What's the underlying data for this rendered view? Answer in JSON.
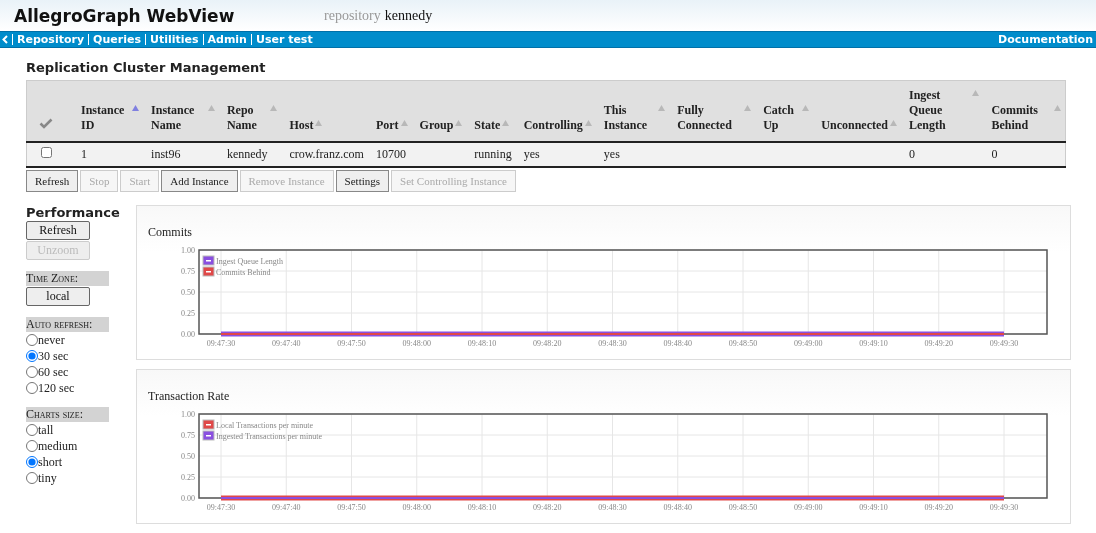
{
  "header": {
    "title": "AllegroGraph WebView",
    "repository_label": "repository",
    "repository_name": "kennedy"
  },
  "nav": {
    "items": [
      "Repository",
      "Queries",
      "Utilities",
      "Admin",
      "User test"
    ],
    "right": "Documentation"
  },
  "cluster": {
    "title": "Replication Cluster Management",
    "table": {
      "columns": [
        {
          "label": "Instance ID",
          "sorted": true
        },
        {
          "label": "Instance Name",
          "sorted": false
        },
        {
          "label": "Repo Name",
          "sorted": false
        },
        {
          "label": "Host",
          "sorted": false
        },
        {
          "label": "Port",
          "sorted": false
        },
        {
          "label": "Group",
          "sorted": false
        },
        {
          "label": "State",
          "sorted": false
        },
        {
          "label": "Controlling",
          "sorted": false
        },
        {
          "label": "This Instance",
          "sorted": false
        },
        {
          "label": "Fully Connected",
          "sorted": false
        },
        {
          "label": "Catch Up",
          "sorted": false
        },
        {
          "label": "Unconnected",
          "sorted": false
        },
        {
          "label": "Ingest Queue Length",
          "sorted": false
        },
        {
          "label": "Commits Behind",
          "sorted": false
        }
      ],
      "rows": [
        {
          "checked": false,
          "cells": [
            "1",
            "inst96",
            "kennedy",
            "crow.franz.com",
            "10700",
            "",
            "running",
            "yes",
            "yes",
            "",
            "",
            "",
            "0",
            "0"
          ]
        }
      ]
    },
    "buttons": [
      {
        "label": "Refresh",
        "disabled": false
      },
      {
        "label": "Stop",
        "disabled": true
      },
      {
        "label": "Start",
        "disabled": true
      },
      {
        "label": "Add Instance",
        "disabled": false
      },
      {
        "label": "Remove Instance",
        "disabled": true
      },
      {
        "label": "Settings",
        "disabled": false
      },
      {
        "label": "Set Controlling Instance",
        "disabled": true
      }
    ]
  },
  "performance": {
    "title": "Performance",
    "buttons": [
      {
        "label": "Refresh",
        "disabled": false
      },
      {
        "label": "Unzoom",
        "disabled": true
      }
    ],
    "time_zone": {
      "label": "Time Zone:",
      "value": "local"
    },
    "auto_refresh": {
      "label": "Auto refresh:",
      "options": [
        {
          "label": "never",
          "selected": false
        },
        {
          "label": "30 sec",
          "selected": true
        },
        {
          "label": "60 sec",
          "selected": false
        },
        {
          "label": "120 sec",
          "selected": false
        }
      ]
    },
    "charts_size": {
      "label": "Charts size:",
      "options": [
        {
          "label": "tall",
          "selected": false
        },
        {
          "label": "medium",
          "selected": false
        },
        {
          "label": "short",
          "selected": true
        },
        {
          "label": "tiny",
          "selected": false
        }
      ]
    }
  },
  "charts": [
    {
      "chart_data": {
        "type": "line",
        "title": "Commits",
        "grid": true,
        "legend": true,
        "categories": [
          "09:47:30",
          "09:47:40",
          "09:47:50",
          "09:48:00",
          "09:48:10",
          "09:48:20",
          "09:48:30",
          "09:48:40",
          "09:48:50",
          "09:49:00",
          "09:49:10",
          "09:49:20",
          "09:49:30"
        ],
        "series": [
          {
            "name": "Ingest Queue Length",
            "color": "#8a4fe0",
            "values": [
              0,
              0,
              0,
              0,
              0,
              0,
              0,
              0,
              0,
              0,
              0,
              0,
              0
            ]
          },
          {
            "name": "Commits Behind",
            "color": "#e04848",
            "values": [
              0,
              0,
              0,
              0,
              0,
              0,
              0,
              0,
              0,
              0,
              0,
              0,
              0
            ]
          }
        ],
        "ylim": [
          0,
          1
        ],
        "yticks": [
          {
            "value": 0,
            "label": "0.00"
          },
          {
            "value": 0.25,
            "label": "0.25"
          },
          {
            "value": 0.5,
            "label": "0.50"
          },
          {
            "value": 0.75,
            "label": "0.75"
          },
          {
            "value": 1,
            "label": "1.00"
          }
        ]
      }
    },
    {
      "chart_data": {
        "type": "line",
        "title": "Transaction Rate",
        "grid": true,
        "legend": true,
        "categories": [
          "09:47:30",
          "09:47:40",
          "09:47:50",
          "09:48:00",
          "09:48:10",
          "09:48:20",
          "09:48:30",
          "09:48:40",
          "09:48:50",
          "09:49:00",
          "09:49:10",
          "09:49:20",
          "09:49:30"
        ],
        "series": [
          {
            "name": "Local Transactions per minute",
            "color": "#e04848",
            "values": [
              0,
              0,
              0,
              0,
              0,
              0,
              0,
              0,
              0,
              0,
              0,
              0,
              0
            ]
          },
          {
            "name": "Ingested Transactions per minute",
            "color": "#8a4fe0",
            "values": [
              0,
              0,
              0,
              0,
              0,
              0,
              0,
              0,
              0,
              0,
              0,
              0,
              0
            ]
          }
        ],
        "ylim": [
          0,
          1
        ],
        "yticks": [
          {
            "value": 0,
            "label": "0.00"
          },
          {
            "value": 0.25,
            "label": "0.25"
          },
          {
            "value": 0.5,
            "label": "0.50"
          },
          {
            "value": 0.75,
            "label": "0.75"
          },
          {
            "value": 1,
            "label": "1.00"
          }
        ]
      }
    }
  ]
}
